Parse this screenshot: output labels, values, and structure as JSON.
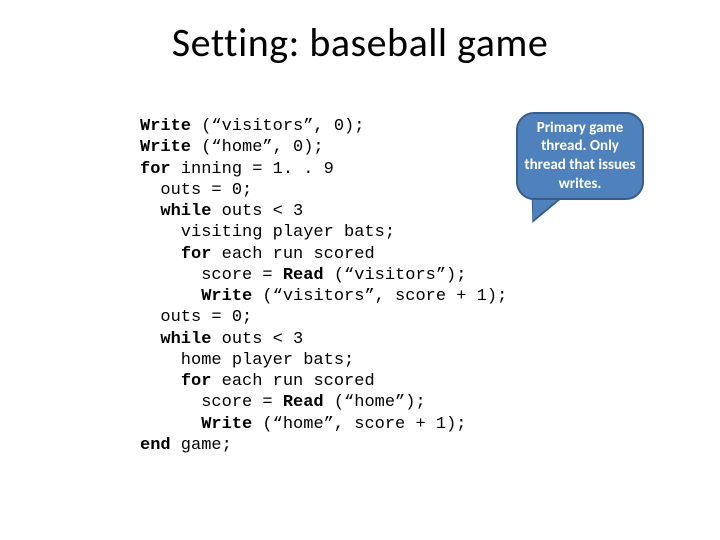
{
  "title": "Setting: baseball game",
  "code": {
    "l1a": "Write",
    "l1b": " (“visitors”, 0);",
    "l2a": "Write",
    "l2b": " (“home”, 0);",
    "l3a": "for",
    "l3b": " inning = 1. . 9",
    "l4": "  outs = 0;",
    "l5a": "  ",
    "l5b": "while",
    "l5c": " outs < 3",
    "l6": "    visiting player bats;",
    "l7a": "    ",
    "l7b": "for",
    "l7c": " each run scored",
    "l8a": "      score = ",
    "l8b": "Read",
    "l8c": " (“visitors”);",
    "l9a": "      ",
    "l9b": "Write",
    "l9c": " (“visitors”, score + 1);",
    "l10": "  outs = 0;",
    "l11a": "  ",
    "l11b": "while",
    "l11c": " outs < 3",
    "l12": "    home player bats;",
    "l13a": "    ",
    "l13b": "for",
    "l13c": " each run scored",
    "l14a": "      score = ",
    "l14b": "Read",
    "l14c": " (“home”);",
    "l15a": "      ",
    "l15b": "Write",
    "l15c": " (“home”, score + 1);",
    "l16a": "end",
    "l16b": " game;"
  },
  "callout": "Primary game thread. Only thread that issues writes."
}
